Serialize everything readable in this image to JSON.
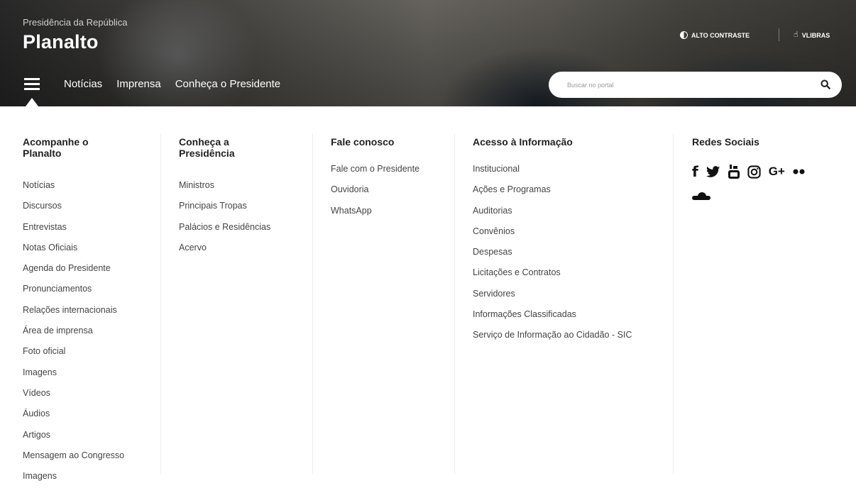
{
  "header": {
    "subtitle": "Presidência da República",
    "title": "Planalto",
    "contrast_label": "ALTO CONTRASTE",
    "libras_label": "VLIBRAS",
    "nav": [
      "Notícias",
      "Imprensa",
      "Conheça o Presidente"
    ],
    "search_placeholder": "Buscar no portal"
  },
  "menu": {
    "col1": {
      "title": "Acompanhe o Planalto",
      "items": [
        "Notícias",
        "Discursos",
        "Entrevistas",
        "Notas Oficiais",
        "Agenda do Presidente",
        "Pronunciamentos",
        "Relações internacionais",
        "Área de imprensa",
        "Foto oficial",
        "Imagens",
        "Vídeos",
        "Áudios",
        "Artigos",
        "Mensagem ao Congresso",
        "Imagens"
      ]
    },
    "col2": {
      "title": "Conheça a Presidência",
      "items": [
        "Ministros",
        "Principais Tropas",
        "Palácios e Residências",
        "Acervo"
      ]
    },
    "col3": {
      "title": "Fale conosco",
      "items": [
        "Fale com o Presidente",
        "Ouvidoria",
        "WhatsApp"
      ]
    },
    "col4": {
      "title": "Acesso à Informação",
      "items": [
        "Institucional",
        "Ações e Programas",
        "Auditorias",
        "Convênios",
        "Despesas",
        "Licitações e Contratos",
        "Servidores",
        "Informações Classificadas",
        "Serviço de Informação ao Cidadão - SIC"
      ]
    },
    "col5": {
      "title": "Redes Sociais",
      "icons": [
        "facebook-icon",
        "twitter-icon",
        "youtube-icon",
        "instagram-icon",
        "google-plus-icon",
        "flickr-icon",
        "soundcloud-icon"
      ],
      "glyphs": {
        "facebook": "f",
        "google": "G+"
      }
    }
  }
}
